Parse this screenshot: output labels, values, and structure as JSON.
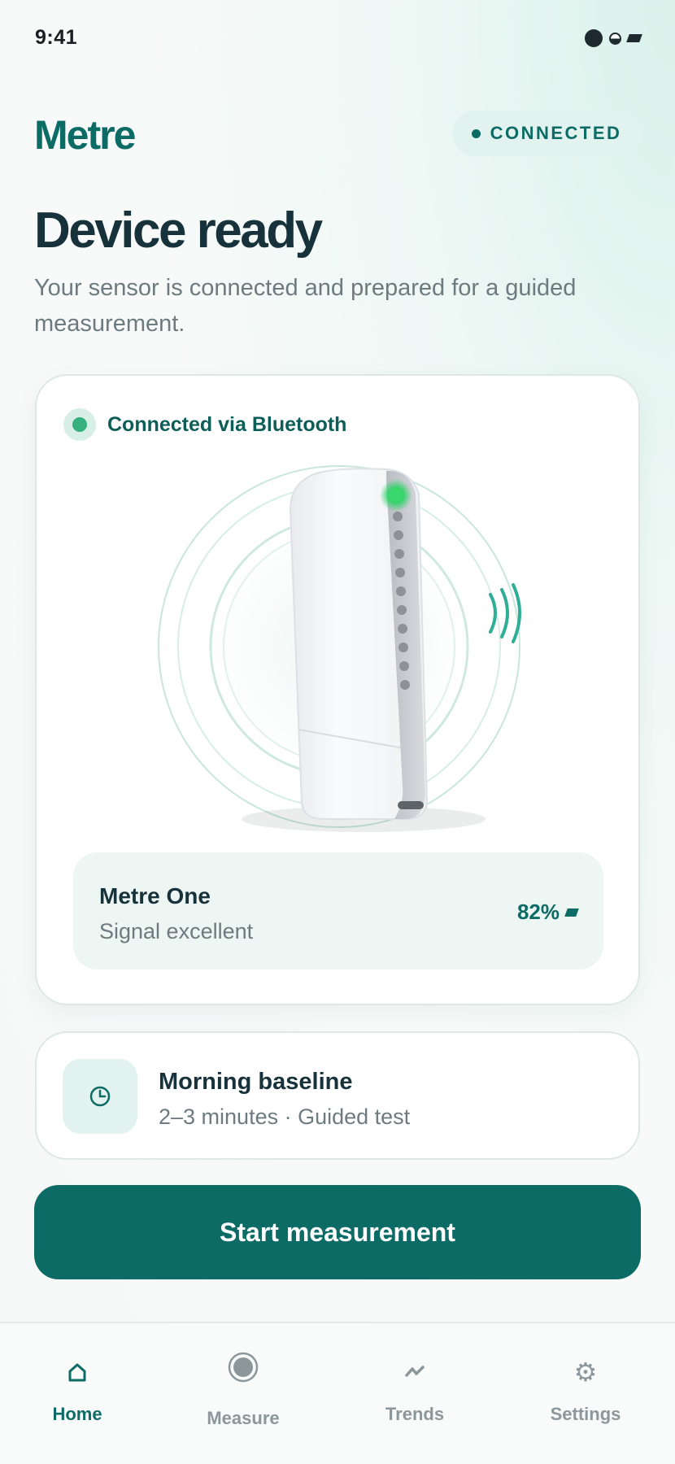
{
  "status_bar": {
    "time": "9:41"
  },
  "header": {
    "brand": "Metre",
    "connection_status": "CONNECTED"
  },
  "hero": {
    "title": "Device ready",
    "subtitle": "Your sensor is connected and prepared for a guided measurement."
  },
  "device_card": {
    "connection_label": "Connected via Bluetooth",
    "device_name": "Metre One",
    "signal": "Signal excellent",
    "battery": "82%"
  },
  "session_card": {
    "title": "Morning baseline",
    "details": "2–3 minutes · Guided test"
  },
  "primary_action": {
    "label": "Start measurement"
  },
  "tab_bar": {
    "tabs": [
      {
        "label": "Home",
        "icon": "home-icon",
        "active": true
      },
      {
        "label": "Measure",
        "icon": "measure-icon",
        "active": false
      },
      {
        "label": "Trends",
        "icon": "trends-icon",
        "active": false
      },
      {
        "label": "Settings",
        "icon": "gear-icon",
        "active": false
      }
    ]
  },
  "colors": {
    "brand": "#0d6b65",
    "accent_green": "#36b07e",
    "text_primary": "#17323a",
    "text_secondary": "#6d7b80"
  }
}
